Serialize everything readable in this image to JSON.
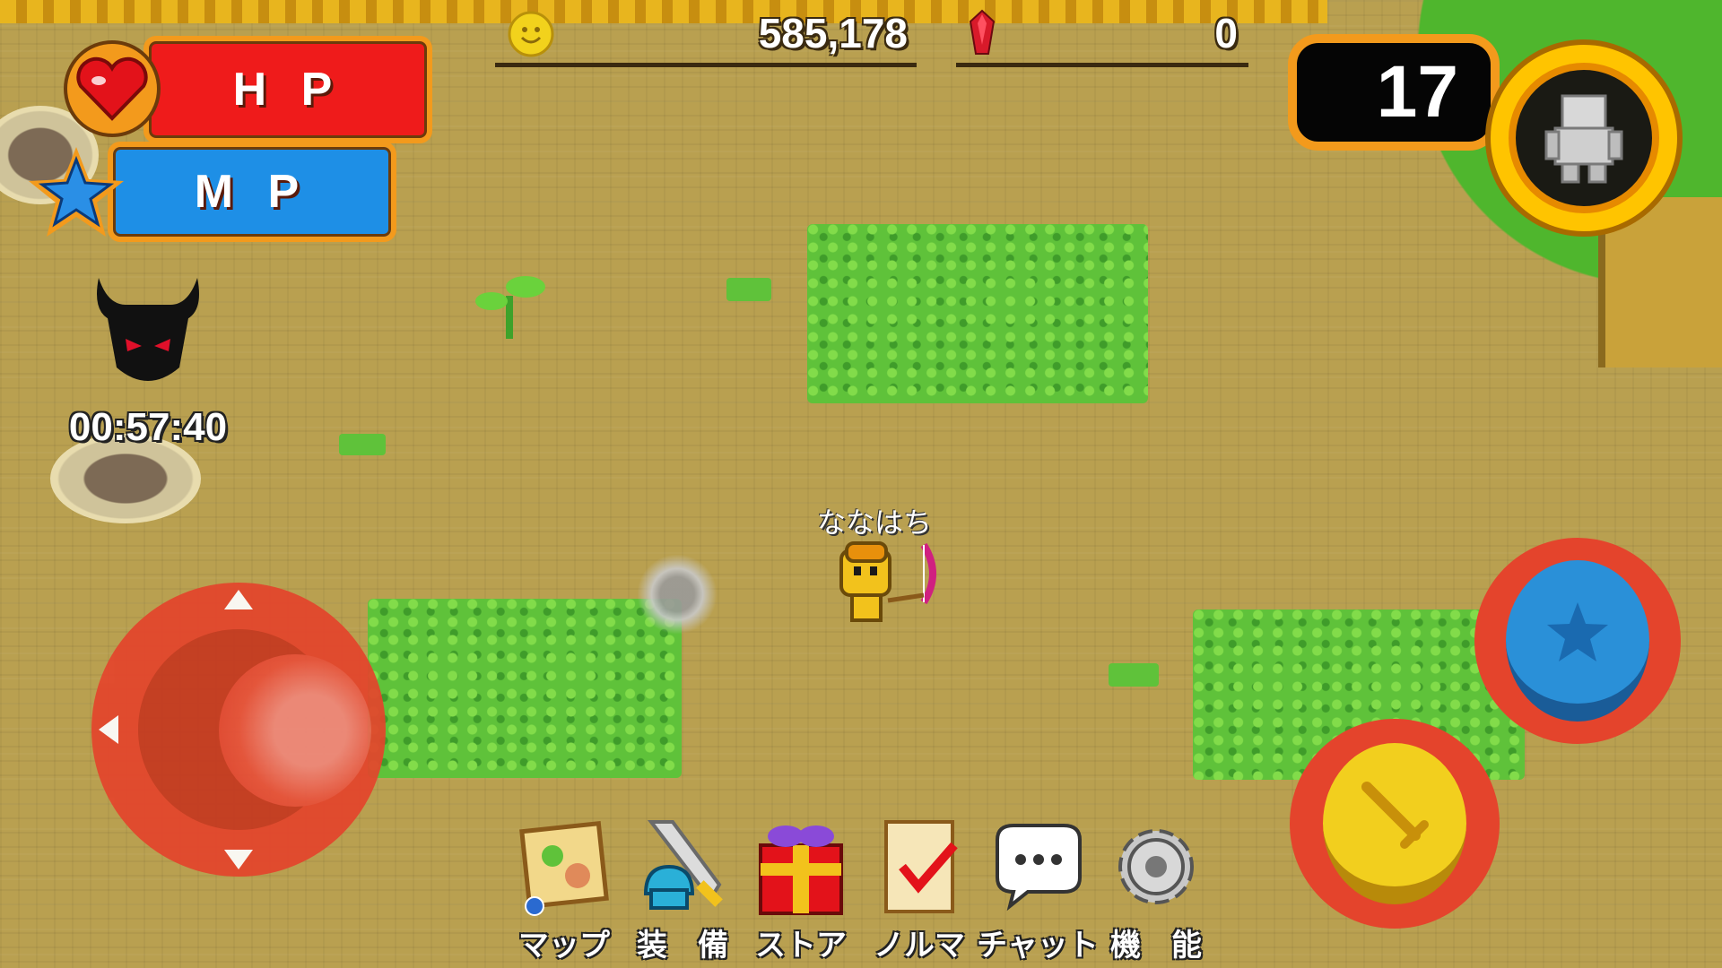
{
  "hud": {
    "hp_label": "H P",
    "mp_label": "M P",
    "coins": "585,178",
    "gems": "0",
    "level": "17",
    "boss_timer": "00:57:40"
  },
  "player": {
    "name": "ななはち"
  },
  "menu": {
    "items": [
      {
        "label": "マップ",
        "icon": "map-icon"
      },
      {
        "label": "装　備",
        "icon": "equipment-icon"
      },
      {
        "label": "ストア",
        "icon": "gift-box-icon"
      },
      {
        "label": "ノルマ",
        "icon": "quota-scroll-icon"
      },
      {
        "label": "チャット",
        "icon": "chat-bubble-icon"
      },
      {
        "label": "機　能",
        "icon": "gear-icon"
      }
    ]
  },
  "controls": {
    "skill_button_icon": "star-icon",
    "attack_button_icon": "sword-icon",
    "joystick_icon": "dpad-arrows"
  },
  "colors": {
    "hp": "#ef1b1b",
    "mp": "#1e8fe6",
    "frame": "#f39a1c",
    "ground": "#b9a050",
    "grass": "#5fc23a"
  }
}
